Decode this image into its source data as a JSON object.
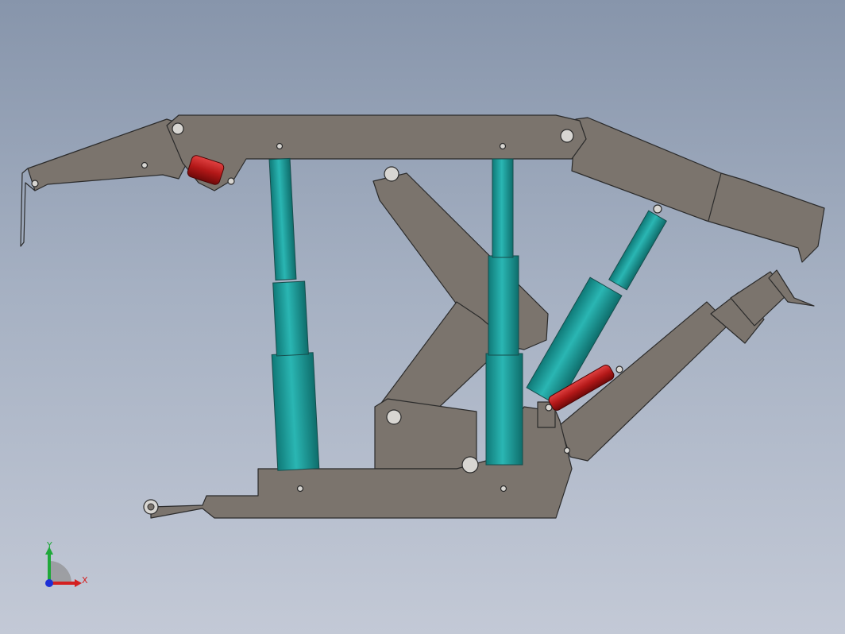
{
  "viewport": {
    "background_top": "#8795ab",
    "background_bottom": "#c3c9d6"
  },
  "model": {
    "frame_color": "#7b746d",
    "leg_color": "#1d9e9c",
    "side_cylinder_color": "#b91c1c",
    "outline_color": "#2b2b2b"
  },
  "triad": {
    "x_label": "X",
    "y_label": "Y",
    "x_color": "#d42020",
    "y_color": "#1fa83a",
    "z_color": "#1d2fd6"
  }
}
